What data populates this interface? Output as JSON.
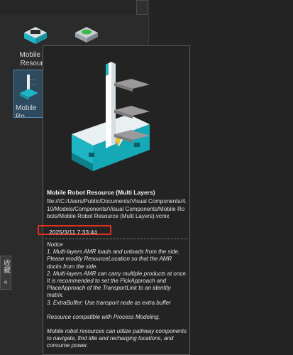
{
  "library": {
    "items": [
      {
        "label": "Mobile Ro Resource",
        "selected": false
      },
      {
        "label": "",
        "selected": false
      },
      {
        "label": "Mobile Ro Resource",
        "selected": true
      }
    ]
  },
  "side_tab": {
    "label": "收藏",
    "icon": "chevron-double-left-icon"
  },
  "tooltip": {
    "title": "Mobile Robot Resource (Multi Layers)",
    "path": "file:///C:/Users/Public/Documents/Visual Components/4.10/Models/Components/Visual Components/Mobile Robots/Mobile Robot Resource (Multi Layers).vcmx",
    "date": "2025/3/11 7:33:44",
    "notes": [
      "Notice",
      "1. Multi-layers AMR loads and unloads from the side. Please modify ResourceLocation so that the AMR docks from the side.",
      "2. Multi-layers AMR can carry multiple products at once. It is recommended to set the PickApproach and PlaceApproach of the TransportLink to an identity matrix.",
      "3. ExtraBuffer: Use transport node as extra buffer",
      "",
      "Resource compatible with Process Modeling.",
      "",
      "Mobile robot resources can utilize pathway components to navigate, find idle and recharging locations, and consume power."
    ]
  },
  "colors": {
    "highlight": "#e0301e",
    "teal": "#1fb6c4",
    "selection": "#4f88b0"
  }
}
